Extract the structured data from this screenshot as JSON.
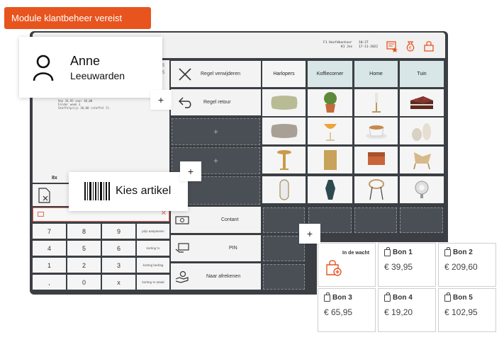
{
  "badge": {
    "module_required": "Module klantbeheer vereist"
  },
  "user": {
    "name": "Anne",
    "location": "Leeuwarden"
  },
  "header": {
    "branch": "F1 Hoofdkantoor",
    "register": "K1 Jos",
    "time": "10:27",
    "date": "17-11-2022",
    "icons": [
      "receipt-star-icon",
      "money-bag-icon",
      "lock-icon"
    ]
  },
  "receipt": {
    "lines": "Van 34,95 voor 30,00\nFolder week 3\nStaffelprijs 30,00 (staffel 5)",
    "qty": "8x",
    "side_digits": [
      "5",
      "5"
    ]
  },
  "actions": {
    "remove_line": "Regel verwijderen",
    "return_line": "Regel retour",
    "cash": "Contant",
    "pin": "PIN",
    "checkout": "Naar afrekenen"
  },
  "categories": [
    "Harlopers",
    "Koffiecorner",
    "Home",
    "Tuin"
  ],
  "products": [
    [
      "pillow-green",
      "plant-pot",
      "candle-holder",
      "cake"
    ],
    [
      "pillow-beige",
      "cocktail-glass",
      "coffee-cup",
      "vases"
    ],
    [
      "side-table",
      "board",
      "chair-orange",
      "rattan-chair"
    ],
    [
      "mirror",
      "vase-dark",
      "bar-stool",
      "lamp"
    ]
  ],
  "keypad": [
    [
      "7",
      "8",
      "9",
      "prijs aanpassen"
    ],
    [
      "4",
      "5",
      "6",
      "korting %"
    ],
    [
      "1",
      "2",
      "3",
      "korting bedrag"
    ],
    [
      ",",
      "0",
      "x",
      "korting % totaal"
    ]
  ],
  "scan": {
    "label": "Kies artikel"
  },
  "bonnen": {
    "on_hold_label": "In de wacht",
    "items": [
      {
        "label": "Bon 1",
        "amount": "€ 39,95"
      },
      {
        "label": "Bon 2",
        "amount": "€ 209,60"
      },
      {
        "label": "Bon 3",
        "amount": "€ 65,95"
      },
      {
        "label": "Bon 4",
        "amount": "€ 19,20"
      },
      {
        "label": "Bon 5",
        "amount": "€ 102,95"
      }
    ]
  },
  "colors": {
    "accent": "#e8541e",
    "frame": "#3b3f44",
    "category_active": "#d9e6e8",
    "red": "#e06a57"
  }
}
